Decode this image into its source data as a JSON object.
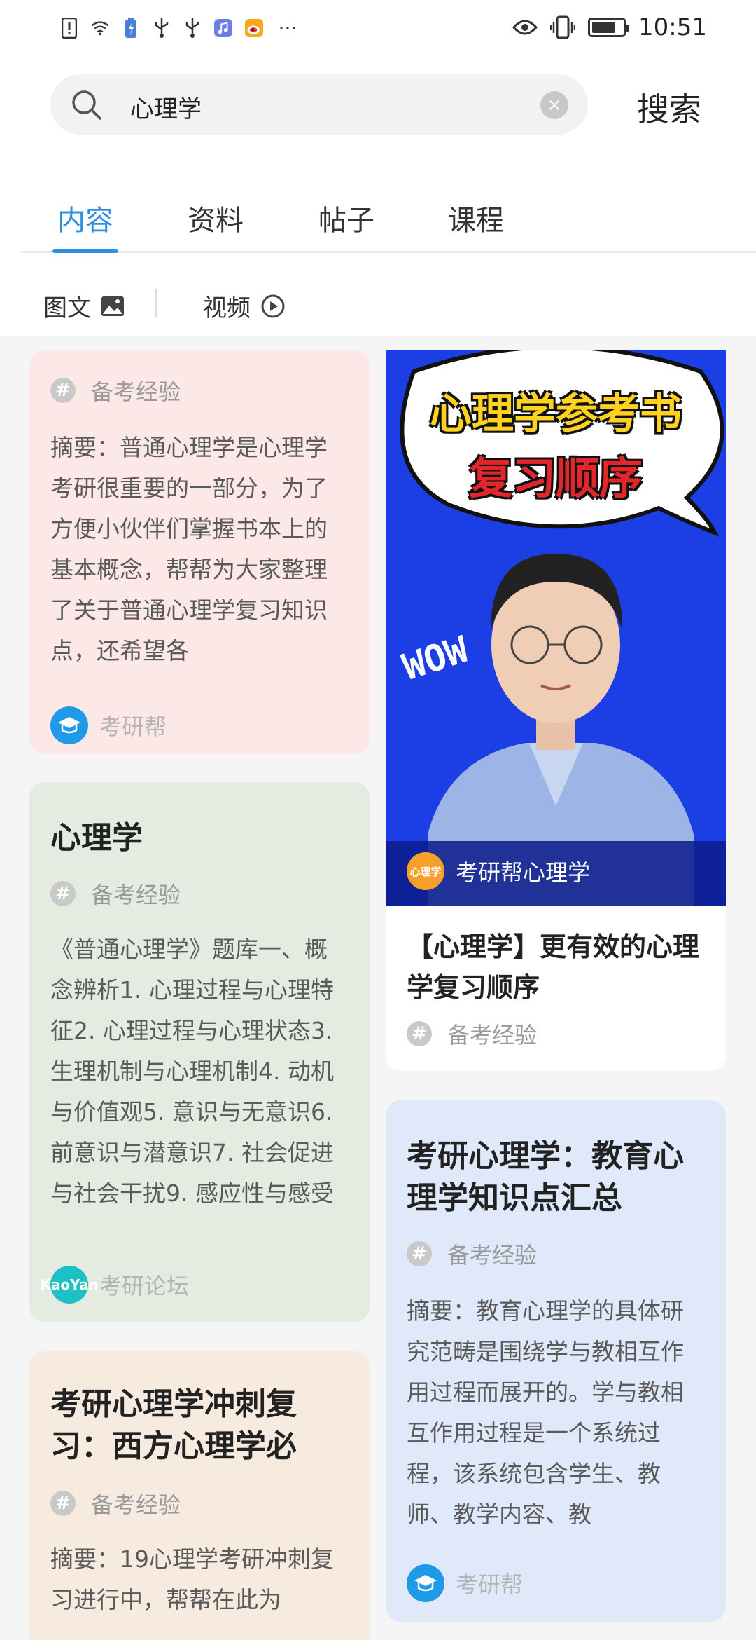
{
  "status_bar": {
    "time": "10:51",
    "more": "···"
  },
  "search": {
    "query": "心理学",
    "button_label": "搜索"
  },
  "tabs": [
    {
      "label": "内容",
      "active": true
    },
    {
      "label": "资料",
      "active": false
    },
    {
      "label": "帖子",
      "active": false
    },
    {
      "label": "课程",
      "active": false
    }
  ],
  "filters": {
    "image_text_label": "图文",
    "video_label": "视频"
  },
  "colors": {
    "accent": "#2f8fe3",
    "pink_card": "#fde8e8",
    "green_card": "#e4ece1",
    "peach_card": "#f7ebe0",
    "blue_card": "#dfe9fa"
  },
  "feed": {
    "card1": {
      "tag": "备考经验",
      "summary": "摘要：普通心理学是心理学考研很重要的一部分，为了方便小伙伴们掌握书本上的基本概念，帮帮为大家整理了关于普通心理学复习知识点，还希望各",
      "author": "考研帮"
    },
    "card2": {
      "title": "心理学",
      "tag": "备考经验",
      "summary": "《普通心理学》题库一、概念辨析1. 心理过程与心理特征2. 心理过程与心理状态3. 生理机制与心理机制4. 动机与价值观5. 意识与无意识6. 前意识与潜意识7. 社会促进与社会干扰9. 感应性与感受",
      "author": "考研论坛",
      "avatar_text": "KaoYan"
    },
    "card3": {
      "title": "考研心理学冲刺复习：西方心理学必",
      "tag": "备考经验",
      "summary": "摘要：19心理学考研冲刺复习进行中，帮帮在此为"
    },
    "video_card": {
      "banner_line1": "心理学参考书",
      "banner_line2": "复习顺序",
      "wow": "WOW",
      "channel_badge": "心理学",
      "channel": "考研帮心理学",
      "title": "【心理学】更有效的心理学复习顺序",
      "tag": "备考经验"
    },
    "card4": {
      "title": "考研心理学：教育心理学知识点汇总",
      "tag": "备考经验",
      "summary": "摘要：教育心理学的具体研究范畴是围绕学与教相互作用过程而展开的。学与教相互作用过程是一个系统过程，该系统包含学生、教师、教学内容、教",
      "author": "考研帮"
    }
  }
}
